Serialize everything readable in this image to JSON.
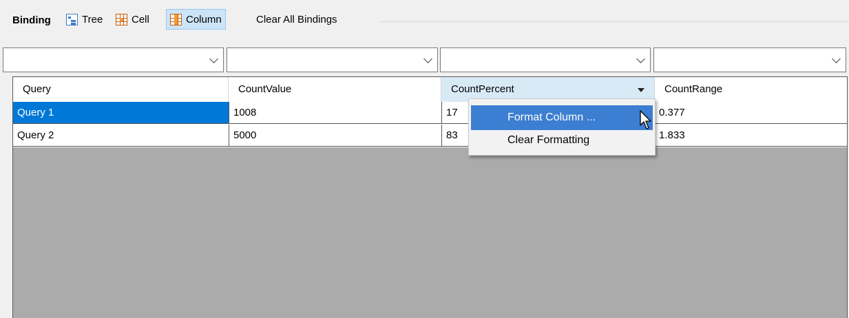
{
  "toolbar": {
    "title": "Binding",
    "buttons": [
      {
        "label": "Tree",
        "icon": "tree-icon",
        "selected": false
      },
      {
        "label": "Cell",
        "icon": "cell-icon",
        "selected": false
      },
      {
        "label": "Column",
        "icon": "column-icon",
        "selected": true
      }
    ],
    "clear_all": "Clear All Bindings"
  },
  "combos": [
    "",
    "",
    "",
    ""
  ],
  "grid": {
    "columns": [
      "Query",
      "CountValue",
      "CountPercent",
      "CountRange"
    ],
    "rows": [
      [
        "Query 1",
        "1008",
        "17",
        "0.377"
      ],
      [
        "Query 2",
        "5000",
        "83",
        "1.833"
      ]
    ],
    "selected_cell": "Query 1",
    "active_header": "CountPercent"
  },
  "context_menu": {
    "items": [
      "Format Column ...",
      "Clear Formatting"
    ],
    "hovered": "Format Column ..."
  },
  "colors": {
    "selection": "#0078d7",
    "menu_hover": "#3c7ed1",
    "header_active": "#d9eaf7",
    "grid_background": "#ababab",
    "toolbar_selected": "#cce4f7"
  }
}
